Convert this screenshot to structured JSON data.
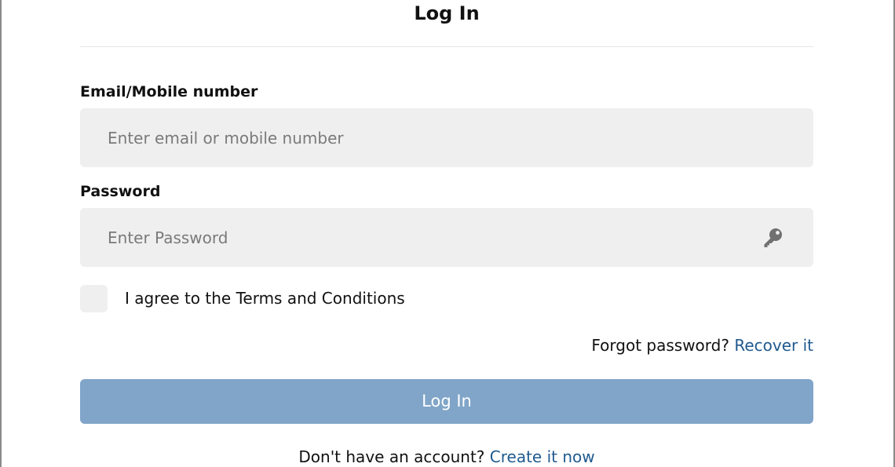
{
  "dialog": {
    "title": "Log In"
  },
  "email": {
    "label": "Email/Mobile number",
    "placeholder": "Enter email or mobile number",
    "value": ""
  },
  "password": {
    "label": "Password",
    "placeholder": "Enter Password",
    "value": "",
    "icon": "key-icon"
  },
  "terms": {
    "checked": false,
    "label": "I agree to the Terms and Conditions"
  },
  "forgot": {
    "prompt": "Forgot password?",
    "link": "Recover it"
  },
  "login_button": {
    "label": "Log In",
    "disabled": true
  },
  "signup": {
    "prompt": "Don't have an account?",
    "link": "Create it now"
  },
  "colors": {
    "accent": "#1f5a8f",
    "button_disabled": "#80a5c8",
    "field_background": "#efefef"
  }
}
